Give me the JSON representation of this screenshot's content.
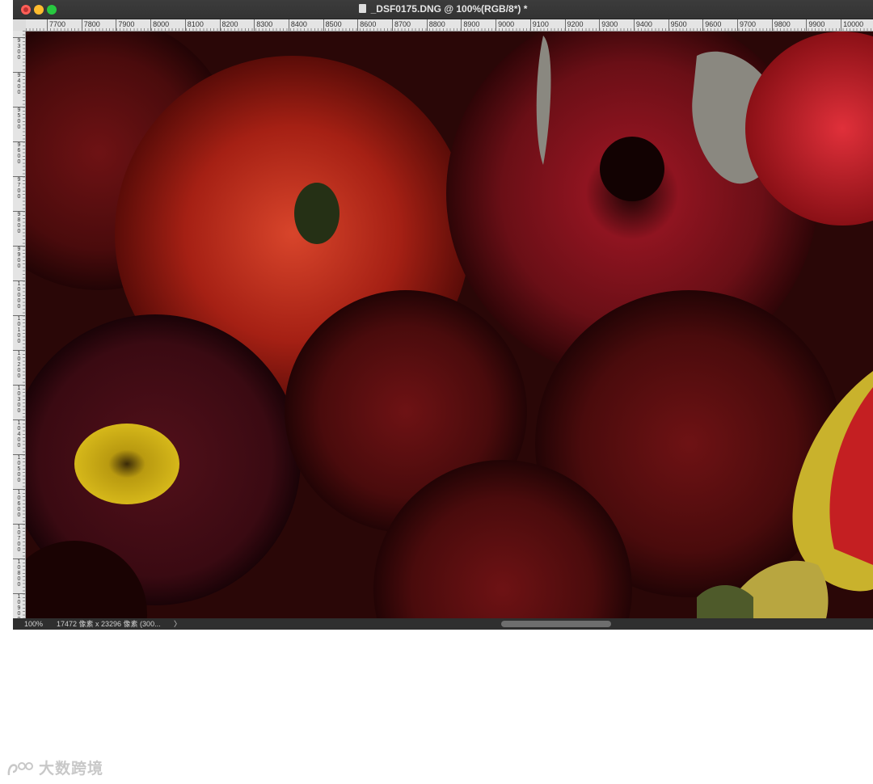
{
  "window": {
    "title": "_DSF0175.DNG @ 100%(RGB/8*) *"
  },
  "ruler": {
    "horizontal_labels": [
      "7700",
      "7800",
      "7900",
      "8000",
      "8100",
      "8200",
      "8300",
      "8400",
      "8500",
      "8600",
      "8700",
      "8800",
      "8900",
      "9000",
      "9100",
      "9200",
      "9300",
      "9400",
      "9500",
      "9600",
      "9700",
      "9800",
      "9900",
      "10000"
    ],
    "vertical_labels": [
      "9300",
      "9400",
      "9500",
      "9600",
      "9700",
      "9800",
      "9900",
      "10000",
      "10100",
      "10200",
      "10300",
      "10400",
      "10500",
      "10600",
      "10700",
      "10800",
      "10900"
    ]
  },
  "canvas": {
    "image_description": "Close-up photo of dark red chrysanthemums, ranunculus and gerbera flowers"
  },
  "status": {
    "zoom": "100%",
    "doc_info": "17472 像素 x 23296 像素 (300...",
    "arrow": "〉"
  },
  "watermark": {
    "text": "大数跨境"
  },
  "colors": {
    "titlebar": "#333333",
    "ruler": "#e4e4e4",
    "canvas_dark": "#2a0707",
    "flower_red": "#b31f1f",
    "statusbar": "#2f2f2f"
  }
}
